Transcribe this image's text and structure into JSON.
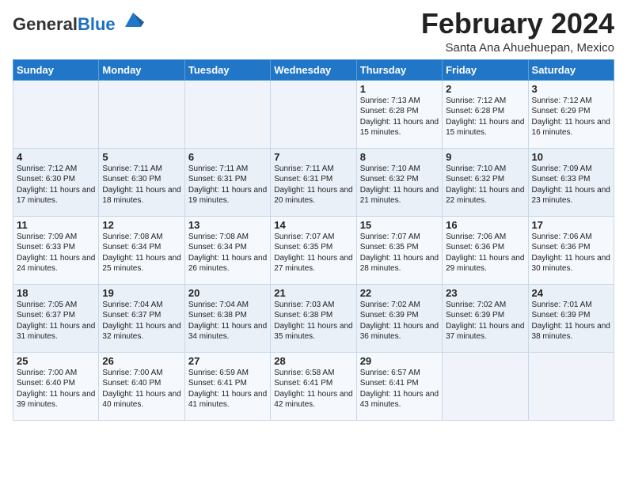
{
  "logo": {
    "general": "General",
    "blue": "Blue"
  },
  "header": {
    "title": "February 2024",
    "subtitle": "Santa Ana Ahuehuepan, Mexico"
  },
  "days_of_week": [
    "Sunday",
    "Monday",
    "Tuesday",
    "Wednesday",
    "Thursday",
    "Friday",
    "Saturday"
  ],
  "weeks": [
    [
      {
        "day": "",
        "info": ""
      },
      {
        "day": "",
        "info": ""
      },
      {
        "day": "",
        "info": ""
      },
      {
        "day": "",
        "info": ""
      },
      {
        "day": "1",
        "info": "Sunrise: 7:13 AM\nSunset: 6:28 PM\nDaylight: 11 hours and 15 minutes."
      },
      {
        "day": "2",
        "info": "Sunrise: 7:12 AM\nSunset: 6:28 PM\nDaylight: 11 hours and 15 minutes."
      },
      {
        "day": "3",
        "info": "Sunrise: 7:12 AM\nSunset: 6:29 PM\nDaylight: 11 hours and 16 minutes."
      }
    ],
    [
      {
        "day": "4",
        "info": "Sunrise: 7:12 AM\nSunset: 6:30 PM\nDaylight: 11 hours and 17 minutes."
      },
      {
        "day": "5",
        "info": "Sunrise: 7:11 AM\nSunset: 6:30 PM\nDaylight: 11 hours and 18 minutes."
      },
      {
        "day": "6",
        "info": "Sunrise: 7:11 AM\nSunset: 6:31 PM\nDaylight: 11 hours and 19 minutes."
      },
      {
        "day": "7",
        "info": "Sunrise: 7:11 AM\nSunset: 6:31 PM\nDaylight: 11 hours and 20 minutes."
      },
      {
        "day": "8",
        "info": "Sunrise: 7:10 AM\nSunset: 6:32 PM\nDaylight: 11 hours and 21 minutes."
      },
      {
        "day": "9",
        "info": "Sunrise: 7:10 AM\nSunset: 6:32 PM\nDaylight: 11 hours and 22 minutes."
      },
      {
        "day": "10",
        "info": "Sunrise: 7:09 AM\nSunset: 6:33 PM\nDaylight: 11 hours and 23 minutes."
      }
    ],
    [
      {
        "day": "11",
        "info": "Sunrise: 7:09 AM\nSunset: 6:33 PM\nDaylight: 11 hours and 24 minutes."
      },
      {
        "day": "12",
        "info": "Sunrise: 7:08 AM\nSunset: 6:34 PM\nDaylight: 11 hours and 25 minutes."
      },
      {
        "day": "13",
        "info": "Sunrise: 7:08 AM\nSunset: 6:34 PM\nDaylight: 11 hours and 26 minutes."
      },
      {
        "day": "14",
        "info": "Sunrise: 7:07 AM\nSunset: 6:35 PM\nDaylight: 11 hours and 27 minutes."
      },
      {
        "day": "15",
        "info": "Sunrise: 7:07 AM\nSunset: 6:35 PM\nDaylight: 11 hours and 28 minutes."
      },
      {
        "day": "16",
        "info": "Sunrise: 7:06 AM\nSunset: 6:36 PM\nDaylight: 11 hours and 29 minutes."
      },
      {
        "day": "17",
        "info": "Sunrise: 7:06 AM\nSunset: 6:36 PM\nDaylight: 11 hours and 30 minutes."
      }
    ],
    [
      {
        "day": "18",
        "info": "Sunrise: 7:05 AM\nSunset: 6:37 PM\nDaylight: 11 hours and 31 minutes."
      },
      {
        "day": "19",
        "info": "Sunrise: 7:04 AM\nSunset: 6:37 PM\nDaylight: 11 hours and 32 minutes."
      },
      {
        "day": "20",
        "info": "Sunrise: 7:04 AM\nSunset: 6:38 PM\nDaylight: 11 hours and 34 minutes."
      },
      {
        "day": "21",
        "info": "Sunrise: 7:03 AM\nSunset: 6:38 PM\nDaylight: 11 hours and 35 minutes."
      },
      {
        "day": "22",
        "info": "Sunrise: 7:02 AM\nSunset: 6:39 PM\nDaylight: 11 hours and 36 minutes."
      },
      {
        "day": "23",
        "info": "Sunrise: 7:02 AM\nSunset: 6:39 PM\nDaylight: 11 hours and 37 minutes."
      },
      {
        "day": "24",
        "info": "Sunrise: 7:01 AM\nSunset: 6:39 PM\nDaylight: 11 hours and 38 minutes."
      }
    ],
    [
      {
        "day": "25",
        "info": "Sunrise: 7:00 AM\nSunset: 6:40 PM\nDaylight: 11 hours and 39 minutes."
      },
      {
        "day": "26",
        "info": "Sunrise: 7:00 AM\nSunset: 6:40 PM\nDaylight: 11 hours and 40 minutes."
      },
      {
        "day": "27",
        "info": "Sunrise: 6:59 AM\nSunset: 6:41 PM\nDaylight: 11 hours and 41 minutes."
      },
      {
        "day": "28",
        "info": "Sunrise: 6:58 AM\nSunset: 6:41 PM\nDaylight: 11 hours and 42 minutes."
      },
      {
        "day": "29",
        "info": "Sunrise: 6:57 AM\nSunset: 6:41 PM\nDaylight: 11 hours and 43 minutes."
      },
      {
        "day": "",
        "info": ""
      },
      {
        "day": "",
        "info": ""
      }
    ]
  ]
}
